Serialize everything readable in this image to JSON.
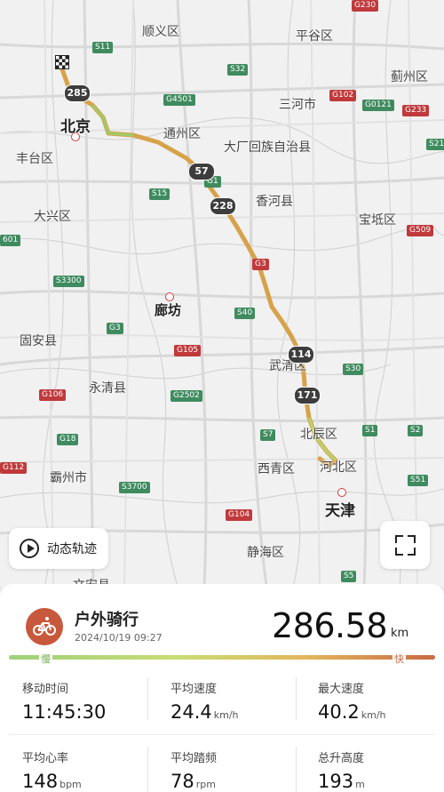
{
  "map": {
    "places": {
      "shunyi": "顺义区",
      "pinggu": "平谷区",
      "jizhou": "蓟州区",
      "beijing": "北京",
      "sanhe": "三河市",
      "tongzhou": "通州区",
      "fengtai": "丰台区",
      "dachang": "大厂回族自治县",
      "daxing": "大兴区",
      "xianghe": "香河县",
      "baodi": "宝坻区",
      "langfang": "廊坊",
      "guan": "固安县",
      "wuqing": "武清区",
      "yongqing": "永清县",
      "beichen": "北辰区",
      "bazhou": "霸州市",
      "xiqing": "西青区",
      "hebei": "河北区",
      "tianjin": "天津",
      "jinghai": "静海区",
      "wenan": "文安县"
    },
    "shields": {
      "s11": "S11",
      "g230": "G230",
      "s32": "S32",
      "g4501": "G4501",
      "g102": "G102",
      "g0121": "G0121",
      "g233": "G233",
      "s21": "S21",
      "g1": "G1",
      "s15": "S15",
      "g509": "G509",
      "s601": "601",
      "g3": "G3",
      "g3_2": "G3",
      "s3300": "S3300",
      "s40": "S40",
      "g105": "G105",
      "g106": "G106",
      "g2502": "G2502",
      "s30": "S30",
      "g18": "G18",
      "s7": "S7",
      "s1": "S1",
      "s2": "S2",
      "g112": "G112",
      "s3700": "S3700",
      "s51": "S51",
      "g104": "G104",
      "s5": "S5"
    },
    "km_markers": [
      "285",
      "57",
      "228",
      "114",
      "171"
    ],
    "replay_label": "动态轨迹",
    "icons": {
      "replay": "play-circle-icon",
      "fullscreen": "fullscreen-icon",
      "start": "checkered-flag-icon"
    }
  },
  "summary": {
    "activity": "户外骑行",
    "datetime": "2024/10/19 09:27",
    "distance": "286.58",
    "distance_unit": "km",
    "icon": "bicycle-icon",
    "accent": "#c8583c",
    "slow": "慢",
    "fast": "快"
  },
  "stats": [
    {
      "label": "移动时间",
      "value": "11:45:30",
      "unit": ""
    },
    {
      "label": "平均速度",
      "value": "24.4",
      "unit": "km/h"
    },
    {
      "label": "最大速度",
      "value": "40.2",
      "unit": "km/h"
    },
    {
      "label": "平均心率",
      "value": "148",
      "unit": "bpm"
    },
    {
      "label": "平均踏频",
      "value": "78",
      "unit": "rpm"
    },
    {
      "label": "总升高度",
      "value": "193",
      "unit": "m"
    }
  ]
}
